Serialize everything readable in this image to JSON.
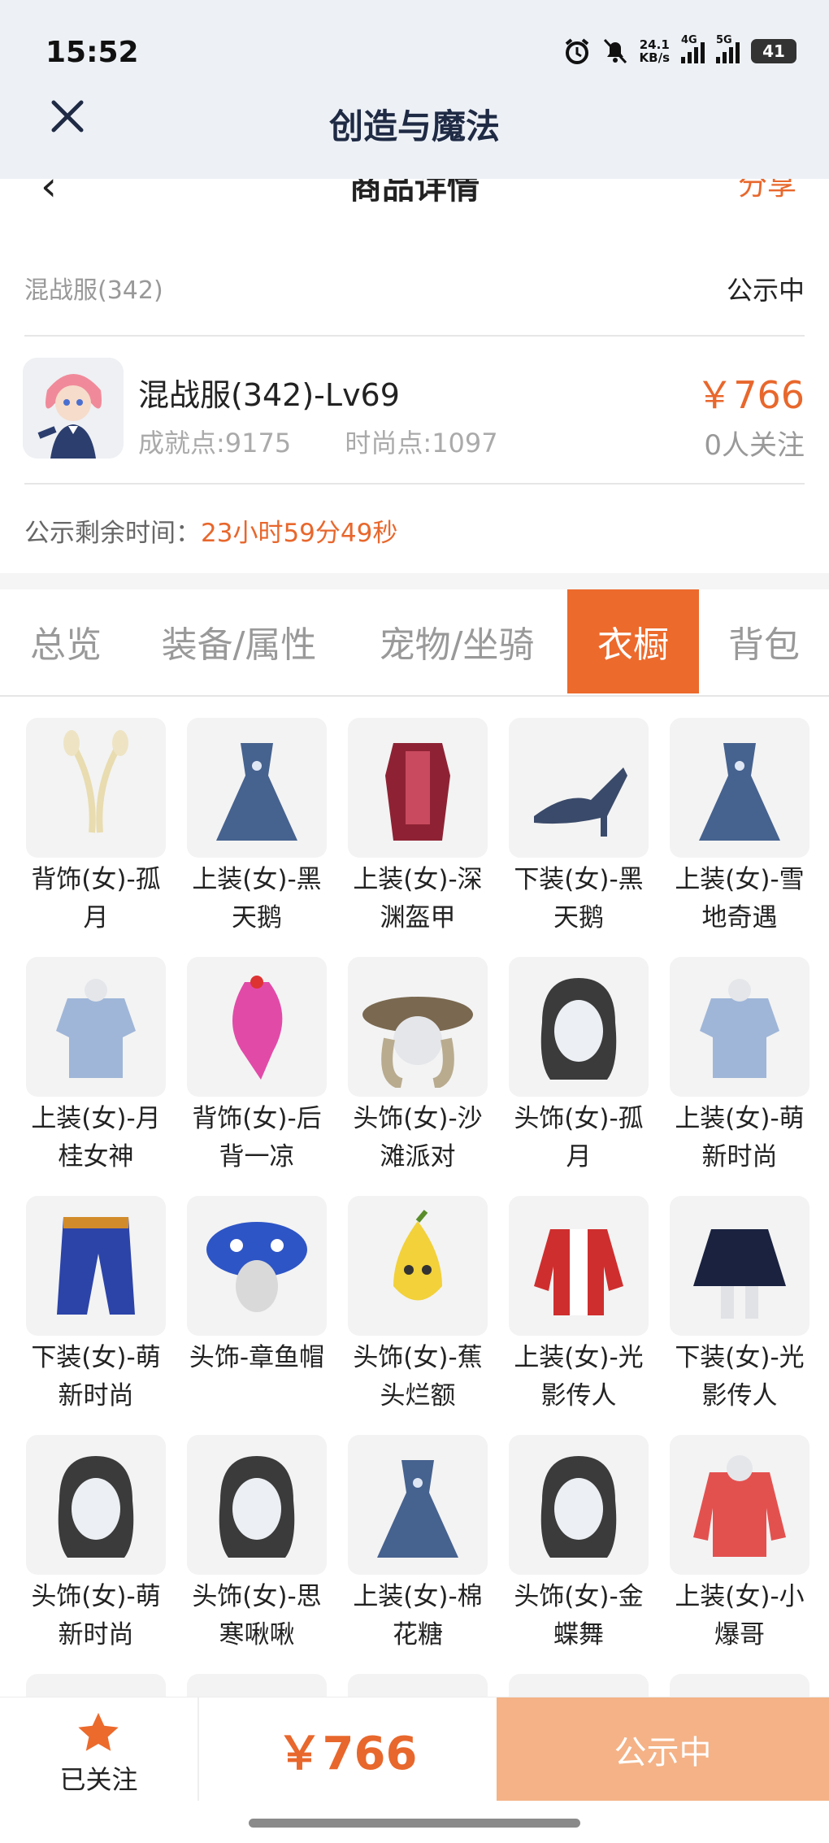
{
  "status_bar": {
    "time": "15:52",
    "net_speed": "24.1",
    "net_unit": "KB/s",
    "sig1": "4G",
    "sig2": "5G",
    "battery": "41"
  },
  "app_bar": {
    "title": "创造与魔法"
  },
  "page_header": {
    "title": "商品详情",
    "share": "分享"
  },
  "listing": {
    "server": "混战服(342)",
    "status": "公示中",
    "character": "混战服(342)-Lv69",
    "achievement": "成就点:9175",
    "fashion": "时尚点:1097",
    "price": "￥766",
    "followers": "0人关注",
    "remain_label": "公示剩余时间：",
    "remain_value": "23小时59分49秒"
  },
  "tabs": [
    {
      "label": "总览"
    },
    {
      "label": "装备/属性"
    },
    {
      "label": "宠物/坐骑"
    },
    {
      "label": "衣橱",
      "active": true
    },
    {
      "label": "背包"
    }
  ],
  "wardrobe": [
    {
      "name": "背饰(女)-孤月",
      "icon": "ribbon-icon"
    },
    {
      "name": "上装(女)-黑天鹅",
      "icon": "dress-icon"
    },
    {
      "name": "上装(女)-深渊盔甲",
      "icon": "armor-icon"
    },
    {
      "name": "下装(女)-黑天鹅",
      "icon": "heels-icon"
    },
    {
      "name": "上装(女)-雪地奇遇",
      "icon": "dress-icon"
    },
    {
      "name": "上装(女)-月桂女神",
      "icon": "top-icon"
    },
    {
      "name": "背饰(女)-后背一凉",
      "icon": "icecream-icon"
    },
    {
      "name": "头饰(女)-沙滩派对",
      "icon": "hat-icon"
    },
    {
      "name": "头饰(女)-孤月",
      "icon": "head-icon"
    },
    {
      "name": "上装(女)-萌新时尚",
      "icon": "top-icon"
    },
    {
      "name": "下装(女)-萌新时尚",
      "icon": "pants-icon"
    },
    {
      "name": "头饰-章鱼帽",
      "icon": "octopus-hat-icon"
    },
    {
      "name": "头饰(女)-蕉头烂额",
      "icon": "banana-icon"
    },
    {
      "name": "上装(女)-光影传人",
      "icon": "jacket-icon"
    },
    {
      "name": "下装(女)-光影传人",
      "icon": "skirt-icon"
    },
    {
      "name": "头饰(女)-萌新时尚",
      "icon": "head-icon"
    },
    {
      "name": "头饰(女)-思寒啾啾",
      "icon": "head-icon"
    },
    {
      "name": "上装(女)-棉花糖",
      "icon": "dress-icon"
    },
    {
      "name": "头饰(女)-金蝶舞",
      "icon": "head-icon"
    },
    {
      "name": "上装(女)-小爆哥",
      "icon": "hoodie-icon"
    },
    {
      "name": "",
      "icon": "item-icon"
    },
    {
      "name": "",
      "icon": "item-icon"
    },
    {
      "name": "",
      "icon": "item-icon"
    },
    {
      "name": "",
      "icon": "item-icon"
    },
    {
      "name": "",
      "icon": "item-icon"
    }
  ],
  "bottom_bar": {
    "follow_label": "已关注",
    "price": "￥766",
    "action": "公示中"
  },
  "colors": {
    "accent": "#e8672c",
    "tab_active": "#ec6a2c",
    "button_disabled": "#f4b286",
    "appbar_bg": "#edf1f6"
  }
}
